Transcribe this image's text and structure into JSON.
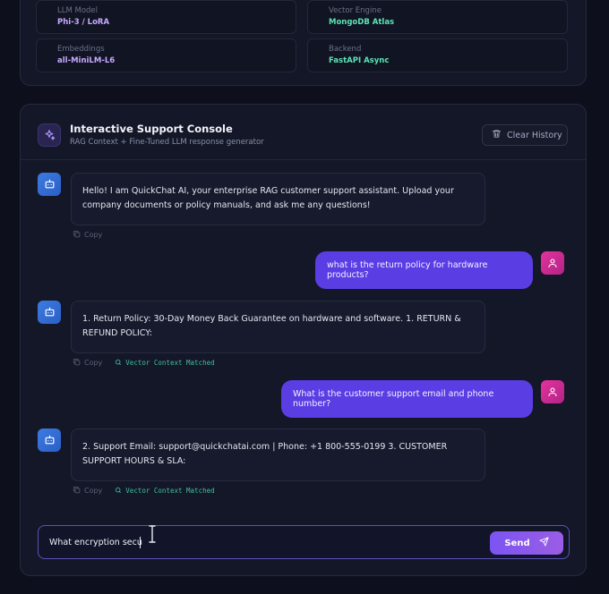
{
  "stats": [
    {
      "label": "LLM Model",
      "value": "Phi-3 / LoRA",
      "color": "#c8a9ff"
    },
    {
      "label": "Vector Engine",
      "value": "MongoDB Atlas",
      "color": "#5de3b5"
    },
    {
      "label": "Embeddings",
      "value": "all-MiniLM-L6",
      "color": "#c8a9ff"
    },
    {
      "label": "Backend",
      "value": "FastAPI Async",
      "color": "#5de3b5"
    }
  ],
  "console": {
    "title": "Interactive Support Console",
    "subtitle": "RAG Context + Fine-Tuned LLM response generator",
    "clear_label": "Clear History"
  },
  "messages": [
    {
      "role": "bot",
      "text": "Hello! I am QuickChat AI, your enterprise RAG customer support assistant. Upload your company documents or policy manuals, and ask me any questions!",
      "copy": "Copy"
    },
    {
      "role": "user",
      "text": "what is the return policy for hardware products?"
    },
    {
      "role": "bot",
      "text": "1. Return Policy: 30-Day Money Back Guarantee on hardware and software. 1. RETURN & REFUND POLICY:",
      "copy": "Copy",
      "tag": "Vector Context Matched"
    },
    {
      "role": "user",
      "text": "What is the customer support email and phone number?"
    },
    {
      "role": "bot",
      "text": "2. Support Email: support@quickchatai.com | Phone: +1 800-555-0199 3. CUSTOMER SUPPORT HOURS & SLA:",
      "copy": "Copy",
      "tag": "Vector Context Matched"
    }
  ],
  "composer": {
    "value": "What encryption secu",
    "send_label": "Send"
  },
  "colors": {
    "accent": "#5a3ee4",
    "bot_avatar": "#3d7be0",
    "user_avatar": "#e3329d",
    "matched": "#3fbfa0"
  }
}
